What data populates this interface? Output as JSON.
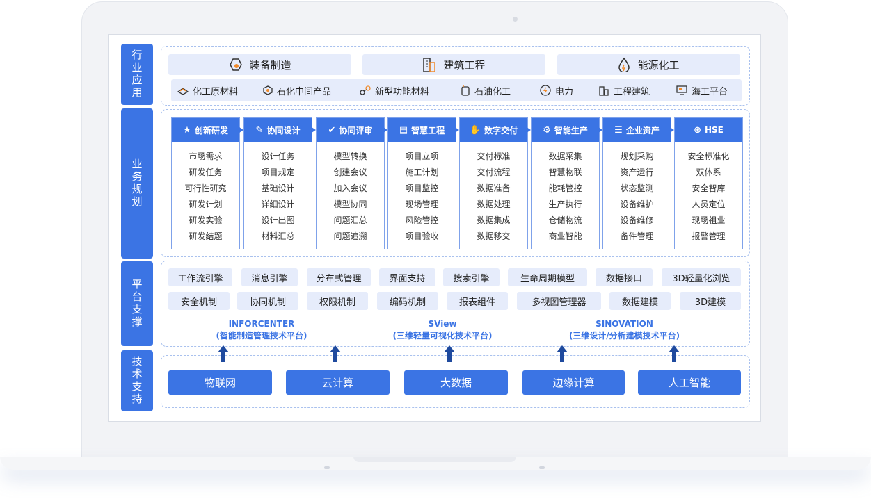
{
  "sections": {
    "industry": "行业应用",
    "business": "业务规划",
    "platform": "平台支撑",
    "tech": "技术支持"
  },
  "industry_main": [
    "装备制造",
    "建筑工程",
    "能源化工"
  ],
  "industry_sub": [
    "化工原材料",
    "石化中间产品",
    "新型功能材料",
    "石油化工",
    "电力",
    "工程建筑",
    "海工平台"
  ],
  "business_columns": [
    {
      "title": "创新研发",
      "items": [
        "市场需求",
        "研发任务",
        "可行性研究",
        "研发计划",
        "研发实验",
        "研发结题"
      ]
    },
    {
      "title": "协同设计",
      "items": [
        "设计任务",
        "项目规定",
        "基础设计",
        "详细设计",
        "设计出图",
        "材料汇总"
      ]
    },
    {
      "title": "协同评审",
      "items": [
        "模型转换",
        "创建会议",
        "加入会议",
        "模型协同",
        "问题汇总",
        "问题追溯"
      ]
    },
    {
      "title": "智慧工程",
      "items": [
        "项目立项",
        "施工计划",
        "项目监控",
        "现场管理",
        "风险管控",
        "项目验收"
      ]
    },
    {
      "title": "数字交付",
      "items": [
        "交付标准",
        "交付流程",
        "数据准备",
        "数据处理",
        "数据集成",
        "数据移交"
      ]
    },
    {
      "title": "智能生产",
      "items": [
        "数据采集",
        "智慧物联",
        "能耗管控",
        "生产执行",
        "仓储物流",
        "商业智能"
      ]
    },
    {
      "title": "企业资产",
      "items": [
        "规划采购",
        "资产运行",
        "状态监测",
        "设备维护",
        "设备维修",
        "备件管理"
      ]
    },
    {
      "title": "HSE",
      "items": [
        "安全标准化",
        "双体系",
        "安全智库",
        "人员定位",
        "现场祖业",
        "报警管理"
      ]
    }
  ],
  "platform_row1": [
    "工作流引擎",
    "消息引擎",
    "分布式管理",
    "界面支持",
    "搜索引擎",
    "生命周期模型",
    "数据接口",
    "3D轻量化浏览"
  ],
  "platform_row2": [
    "安全机制",
    "协同机制",
    "权限机制",
    "编码机制",
    "报表组件",
    "多视图管理器",
    "数据建模",
    "3D建模"
  ],
  "platforms": [
    {
      "name": "INFORCENTER",
      "desc": "(智能制造管理技术平台)"
    },
    {
      "name": "SView",
      "desc": "(三维轻量可视化技术平台)"
    },
    {
      "name": "SINOVATION",
      "desc": "(三维设计/分析建模技术平台)"
    }
  ],
  "tech": [
    "物联网",
    "云计算",
    "大数据",
    "边缘计算",
    "人工智能"
  ],
  "colors": {
    "primary": "#3b74e4",
    "light": "#e6ecfb",
    "border": "#a9c1ee"
  }
}
